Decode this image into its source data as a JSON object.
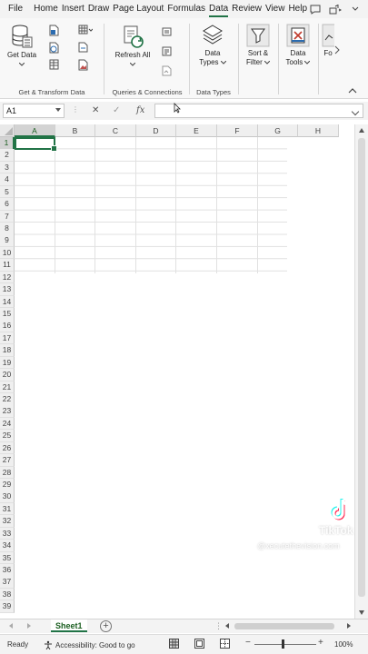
{
  "menu": {
    "tabs": [
      {
        "label": "File",
        "active": false
      },
      {
        "label": "Home",
        "active": false
      },
      {
        "label": "Insert",
        "active": false
      },
      {
        "label": "Draw",
        "active": false
      },
      {
        "label": "Page Layout",
        "active": false
      },
      {
        "label": "Formulas",
        "active": false
      },
      {
        "label": "Data",
        "active": true
      },
      {
        "label": "Review",
        "active": false
      },
      {
        "label": "View",
        "active": false
      },
      {
        "label": "Help",
        "active": false
      }
    ]
  },
  "ribbon": {
    "groups": {
      "get_transform": "Get & Transform Data",
      "queries": "Queries & Connections",
      "data_types": "Data Types"
    },
    "buttons": {
      "get_data": "Get Data",
      "refresh_all": "Refresh All",
      "data_types": "Data Types",
      "sort_filter": "Sort & Filter",
      "data_tools": "Data Tools",
      "forecast": "Fo"
    }
  },
  "formula_bar": {
    "name_box": "A1",
    "cancel_symbol": "✕",
    "enter_symbol": "✓",
    "fx_symbol": "fx",
    "value": ""
  },
  "grid": {
    "columns": [
      "A",
      "B",
      "C",
      "D",
      "E",
      "F",
      "G",
      "H"
    ],
    "rows": [
      "1",
      "2",
      "3",
      "4",
      "5",
      "6",
      "7",
      "8",
      "9",
      "10",
      "11",
      "12",
      "13",
      "14",
      "15",
      "16",
      "17",
      "18",
      "19",
      "20",
      "21",
      "22",
      "23",
      "24",
      "25",
      "26",
      "27",
      "28",
      "29",
      "30",
      "31",
      "32",
      "33",
      "34",
      "35",
      "36",
      "37",
      "38",
      "39"
    ],
    "active_cell": "A1"
  },
  "sheets": {
    "tabs": [
      "Sheet1"
    ],
    "active": "Sheet1",
    "add_symbol": "+"
  },
  "status": {
    "ready": "Ready",
    "accessibility": "Accessibility: Good to go",
    "zoom_minus": "−",
    "zoom_plus": "+",
    "zoom": "100%"
  },
  "watermark": {
    "brand": "TikTok",
    "handle": "@xecutethevision.com"
  },
  "colors": {
    "accent": "#217346",
    "ribbon_bg": "#f8f8f8",
    "header_bg": "#efefef"
  }
}
